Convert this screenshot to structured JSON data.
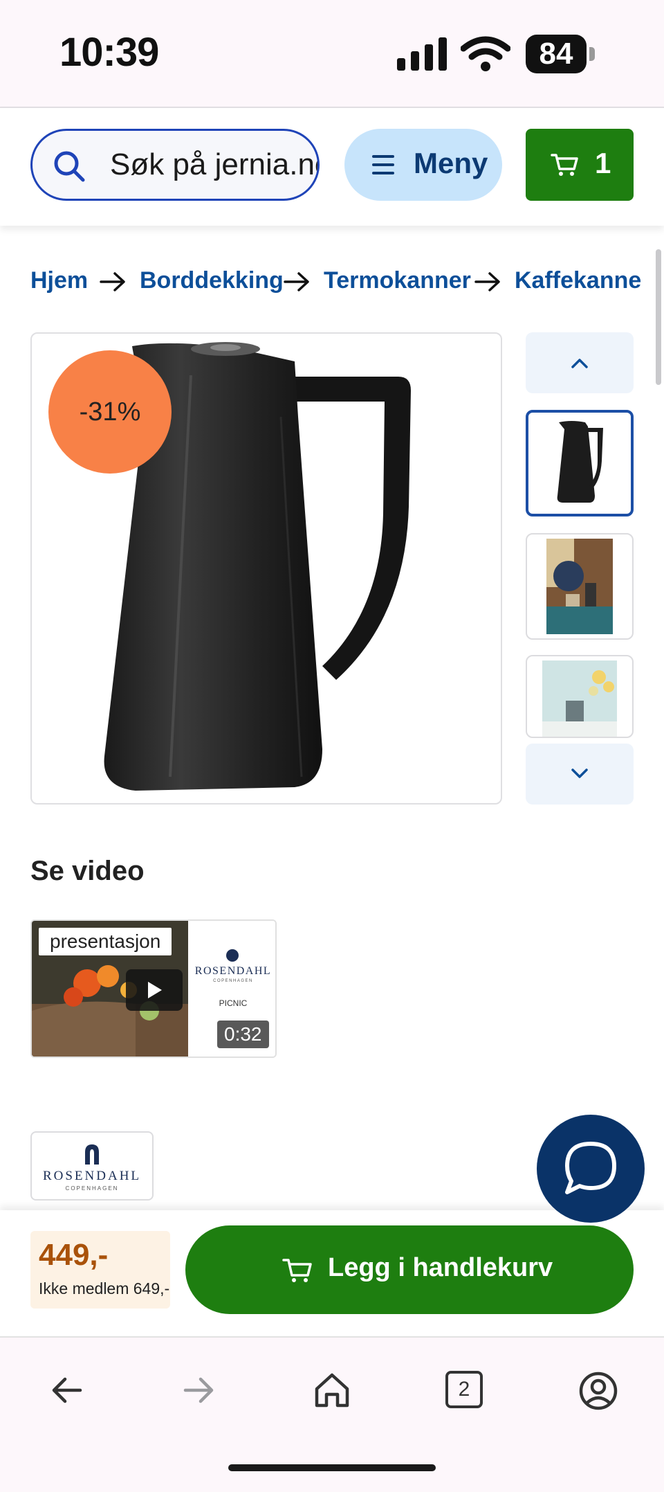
{
  "status_bar": {
    "time": "10:39",
    "battery": "84"
  },
  "header": {
    "search_placeholder": "Søk på jernia.no",
    "menu_label": "Meny",
    "cart_count": "1"
  },
  "breadcrumb": [
    "Hjem",
    "Borddekking",
    "Termokanner",
    "Kaffekanne"
  ],
  "product": {
    "discount_badge": "-31%",
    "thumbnails": [
      "Svart kaffekanne",
      "Kaffekanne på bord",
      "Kaffekanne med blomster"
    ]
  },
  "video": {
    "heading": "Se video",
    "tag": "presentasjon",
    "duration": "0:32",
    "brand_text": "ROSENDAHL",
    "brand_sub": "COPENHAGEN",
    "picnic_text": "PICNIC"
  },
  "brand_logo": {
    "name": "ROSENDAHL",
    "sub": "COPENHAGEN"
  },
  "buy_bar": {
    "price": "449,-",
    "member_price": "Ikke medlem 649,-",
    "add_to_cart": "Legg i handlekurv"
  },
  "browser_toolbar": {
    "tab_count": "2"
  },
  "colors": {
    "brand_blue": "#0d4f99",
    "cart_green": "#1e7e10",
    "discount_orange": "#f88147",
    "chat_navy": "#0a3368",
    "price_brown": "#a9520a"
  },
  "icons": [
    "search-icon",
    "menu-icon",
    "cart-icon",
    "arrow-right-icon",
    "chevron-up-icon",
    "chevron-down-icon",
    "play-icon",
    "chat-icon",
    "back-icon",
    "forward-icon",
    "home-icon",
    "tabs-icon",
    "account-icon"
  ]
}
